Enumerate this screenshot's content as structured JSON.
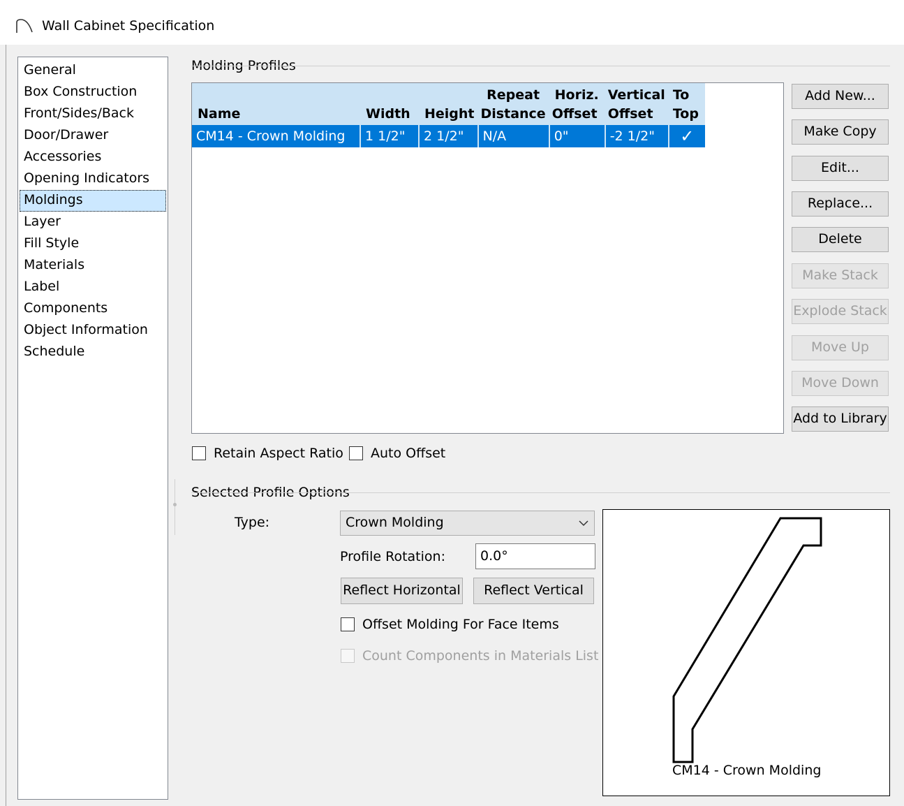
{
  "window": {
    "title": "Wall Cabinet Specification",
    "icon": "arc-icon"
  },
  "nav": {
    "items": [
      {
        "label": "General"
      },
      {
        "label": "Box Construction"
      },
      {
        "label": "Front/Sides/Back"
      },
      {
        "label": "Door/Drawer"
      },
      {
        "label": "Accessories"
      },
      {
        "label": "Opening Indicators"
      },
      {
        "label": "Moldings",
        "selected": true
      },
      {
        "label": "Layer"
      },
      {
        "label": "Fill Style"
      },
      {
        "label": "Materials"
      },
      {
        "label": "Label"
      },
      {
        "label": "Components"
      },
      {
        "label": "Object Information"
      },
      {
        "label": "Schedule"
      }
    ]
  },
  "molding_profiles": {
    "group_label": "Molding Profiles",
    "columns": {
      "name": "Name",
      "width": "Width",
      "height": "Height",
      "repeat_1": "Repeat",
      "repeat_2": "Distance",
      "horiz_1": "Horiz.",
      "horiz_2": "Offset",
      "vert_1": "Vertical",
      "vert_2": "Offset",
      "totop_1": "To",
      "totop_2": "Top"
    },
    "rows": [
      {
        "name": "CM14 - Crown Molding",
        "width": "1 1/2\"",
        "height": "2 1/2\"",
        "repeat_distance": "N/A",
        "horiz_offset": "0\"",
        "vertical_offset": "-2 1/2\"",
        "to_top": "✓",
        "selected": true
      }
    ]
  },
  "buttons": {
    "add_new": "Add New...",
    "make_copy": "Make Copy",
    "edit": "Edit...",
    "replace": "Replace...",
    "delete": "Delete",
    "make_stack": "Make Stack",
    "explode_stack": "Explode Stack",
    "move_up": "Move Up",
    "move_down": "Move Down",
    "add_to_library": "Add to Library"
  },
  "options": {
    "retain_aspect_ratio": {
      "label": "Retain Aspect Ratio",
      "checked": false
    },
    "auto_offset": {
      "label": "Auto Offset",
      "checked": false
    }
  },
  "selected_profile": {
    "group_label": "Selected Profile Options",
    "type_label": "Type:",
    "type_value": "Crown Molding",
    "rotation_label": "Profile Rotation:",
    "rotation_value": "0.0°",
    "reflect_horizontal": "Reflect Horizontal",
    "reflect_vertical": "Reflect Vertical",
    "offset_molding": {
      "label": "Offset Molding For Face Items",
      "checked": false
    },
    "count_components": {
      "label": "Count Components in Materials List",
      "checked": false,
      "disabled": true
    },
    "preview_caption": "CM14 - Crown Molding"
  }
}
